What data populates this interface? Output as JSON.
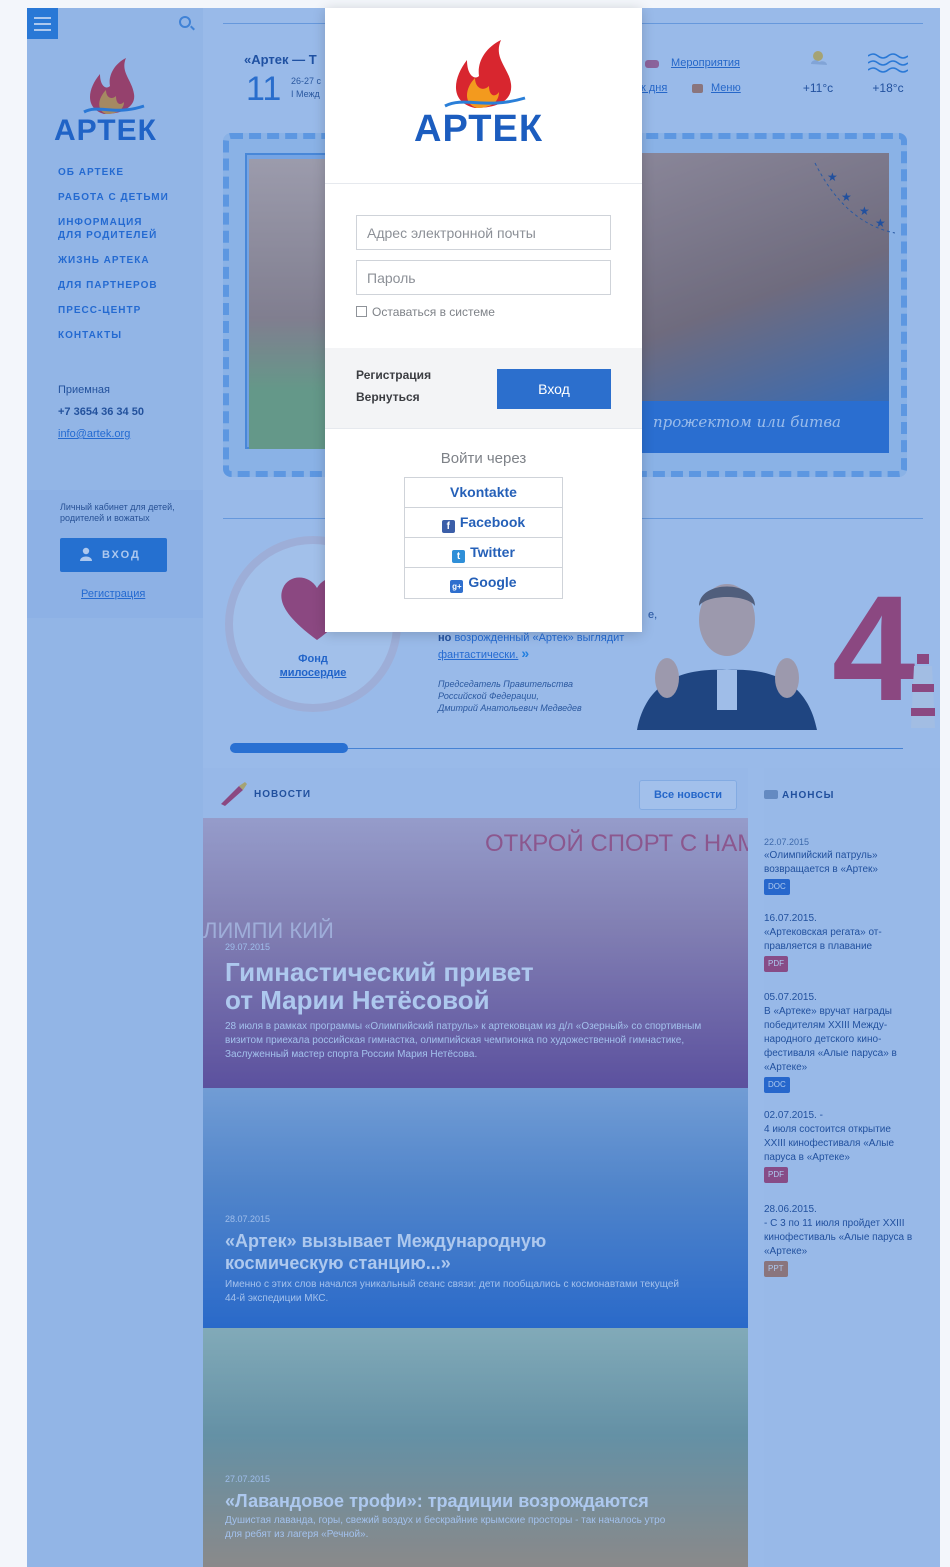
{
  "brand": {
    "name": "АРТЕК"
  },
  "sidebar": {
    "nav": [
      {
        "label": "ОБ АРТЕКЕ"
      },
      {
        "label": "РАБОТА С ДЕТЬМИ"
      },
      {
        "label": "ИНФОРМАЦИЯ"
      },
      {
        "label": "ДЛЯ РОДИТЕЛЕЙ"
      },
      {
        "label": "ЖИЗНЬ АРТЕКА"
      },
      {
        "label": "ДЛЯ ПАРТНЕРОВ"
      },
      {
        "label": "ПРЕСС-ЦЕНТР"
      },
      {
        "label": "КОНТАКТЫ"
      }
    ],
    "reception_label": "Приемная",
    "phone": "+7 3654 36 34 50",
    "email": "info@artek.org",
    "cabinet_text": "Личный кабинет для детей, родителей и вожатых",
    "cabinet_button": "ВХОД",
    "cabinet_register": "Регистрация"
  },
  "header": {
    "event_title": "«Артек — Т",
    "event_day": "11",
    "event_dates_line1": "26-27 с",
    "event_dates_line2": "I Межд",
    "links": [
      {
        "label": "Мероприятия"
      },
      {
        "label": "к дня"
      },
      {
        "label": "Меню"
      }
    ],
    "weather_air": "+11°c",
    "weather_sea": "+18°c"
  },
  "banner": {
    "ribbon_text": "прожектом или битва"
  },
  "charity": {
    "title_line1": "Фонд",
    "title_line2": "милосердие"
  },
  "quote": {
    "line1": "е,",
    "line2_prefix": "но",
    "line2_highlight": "возрожденный «Артек» выглядит",
    "line3": "фантастически.",
    "more": "»",
    "author_line1": "Председатель Правительства",
    "author_line2": "Российской Федерации,",
    "author_line3": "Дмитрий Анатольевич Медведев"
  },
  "big_number": "4",
  "news": {
    "header": "НОВОСТИ",
    "all_button": "Все новости",
    "items": [
      {
        "date": "29.07.2015",
        "title_line1": "Гимнастический привет",
        "title_line2": "от Марии Нетёсовой",
        "desc": "28 июля в рамках программы «Олимпийский патруль» к артековцам из д/л «Озерный» со спортивным визитом приехала российская гимнастка, олимпийская чемпионка по художественной гимнастике, Заслуженный мастер спорта России Мария Нетёсова.",
        "photo_caption": "ОТКРОЙ СПОРТ С НАМ",
        "photo_caption2": "ЛИМПИ КИЙ"
      },
      {
        "date": "28.07.2015",
        "title_line1": "«Артек» вызывает Международную",
        "title_line2": "космическую станцию...»",
        "desc": "Именно с этих слов начался уникальный сеанс связи: дети пообщались с космонавтами текущей 44-й экспедиции МКС."
      },
      {
        "date": "27.07.2015",
        "title_line1": "«Лавандовое трофи»: традиции возрождаются",
        "desc": "Душистая лаванда, горы, свежий воздух и бескрайние крымские просторы - так началось утро для ребят из лагеря «Речной»."
      }
    ]
  },
  "announcements": {
    "header": "АНОНСЫ",
    "items": [
      {
        "date": "22.07.2015",
        "text": "«Олимпийский патруль» возвращается в «Артек»",
        "badge": "DOC",
        "badge_color": "#2763c9"
      },
      {
        "date": "16.07.2015.",
        "text": "«Артековская регата» от-правляется в плавание",
        "badge": "PDF",
        "badge_color": "#c2385a"
      },
      {
        "date": "05.07.2015.",
        "text": "В «Артеке» вручат награды победителям XXIII Между-народного детского кино-фестиваля «Алые паруса» в «Артеке»",
        "badge": "DOC",
        "badge_color": "#2763c9"
      },
      {
        "date": "02.07.2015. -",
        "text": "4 июля состоится открытие XXIII кинофестиваля «Алые паруса в «Артеке»",
        "badge": "PDF",
        "badge_color": "#c2385a"
      },
      {
        "date": "28.06.2015.",
        "text": "- С 3 по 11 июля пройдет XXIII кинофестиваль «Алые паруса в «Артеке»",
        "badge": "PPT",
        "badge_color": "#c77a4a"
      }
    ]
  },
  "login": {
    "email_placeholder": "Адрес электронной почты",
    "password_placeholder": "Пароль",
    "remember_label": "Оставаться в системе",
    "register_link": "Регистрация",
    "back_link": "Вернуться",
    "login_button": "Вход",
    "social_title": "Войти через",
    "social": [
      {
        "label": "Vkontakte",
        "icon": "vk-icon"
      },
      {
        "label": "Facebook",
        "icon": "facebook-icon"
      },
      {
        "label": "Twitter",
        "icon": "twitter-icon"
      },
      {
        "label": "Google",
        "icon": "google-plus-icon"
      }
    ]
  },
  "colors": {
    "accent": "#2c6fcd",
    "overlay": "#2a6ed2",
    "brand_blue": "#1c5dbf",
    "flame_red": "#d8262f",
    "flame_orange": "#f39a1e"
  }
}
